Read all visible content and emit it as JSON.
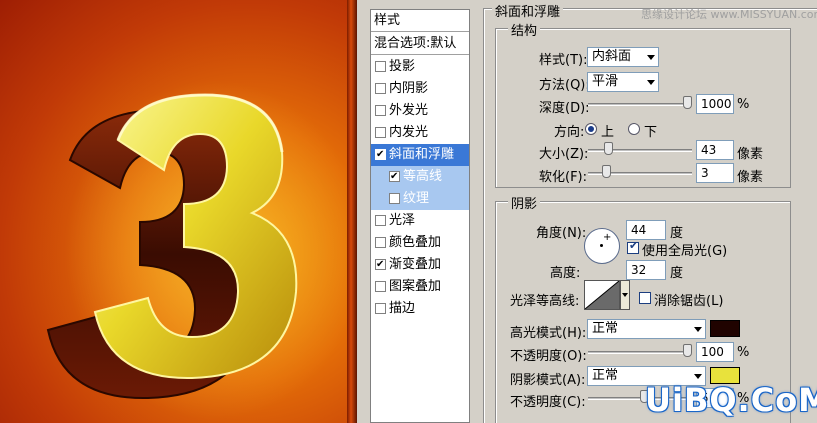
{
  "watermark": "思缘设计论坛  www.MISSYUAN.com",
  "overlay_logo": "UiBQ.CoM",
  "canvas": {
    "artwork": "3"
  },
  "styles_list": {
    "header": "样式",
    "blend_options": "混合选项:默认",
    "items": [
      {
        "label": "投影",
        "checked": false
      },
      {
        "label": "内阴影",
        "checked": false
      },
      {
        "label": "外发光",
        "checked": false
      },
      {
        "label": "内发光",
        "checked": false
      },
      {
        "label": "斜面和浮雕",
        "checked": true,
        "selected": true
      },
      {
        "label": "等高线",
        "checked": true,
        "sub": true
      },
      {
        "label": "纹理",
        "checked": false,
        "sub": true
      },
      {
        "label": "光泽",
        "checked": false
      },
      {
        "label": "颜色叠加",
        "checked": false
      },
      {
        "label": "渐变叠加",
        "checked": true
      },
      {
        "label": "图案叠加",
        "checked": false
      },
      {
        "label": "描边",
        "checked": false
      }
    ]
  },
  "bevel": {
    "title": "斜面和浮雕",
    "structure": {
      "title": "结构",
      "style_label": "样式(T):",
      "style_value": "内斜面",
      "technique_label": "方法(Q):",
      "technique_value": "平滑",
      "depth_label": "深度(D):",
      "depth_value": "1000",
      "depth_unit": "%",
      "depth_level": 1.0,
      "direction_label": "方向:",
      "direction_up": "上",
      "direction_down": "下",
      "direction_selected": "上",
      "size_label": "大小(Z):",
      "size_value": "43",
      "size_unit": "像素",
      "size_level": 0.17,
      "soften_label": "软化(F):",
      "soften_value": "3",
      "soften_unit": "像素",
      "soften_level": 0.15
    },
    "shading": {
      "title": "阴影",
      "angle_label": "角度(N):",
      "angle_value": "44",
      "angle_unit": "度",
      "global_light_label": "使用全局光(G)",
      "global_light_checked": true,
      "altitude_label": "高度:",
      "altitude_value": "32",
      "altitude_unit": "度",
      "gloss_contour_label": "光泽等高线:",
      "anti_alias_label": "消除锯齿(L)",
      "anti_alias_checked": false,
      "highlight_mode_label": "高光模式(H):",
      "highlight_mode_value": "正常",
      "highlight_color": "#200300",
      "highlight_opacity_label": "不透明度(O):",
      "highlight_opacity_value": "100",
      "highlight_opacity_unit": "%",
      "highlight_opacity_level": 1.0,
      "shadow_mode_label": "阴影模式(A):",
      "shadow_mode_value": "正常",
      "shadow_color": "#e8e23c",
      "shadow_opacity_label": "不透明度(C):",
      "shadow_opacity_value": "5",
      "shadow_opacity_unit": "%",
      "shadow_opacity_level": 0.55
    }
  }
}
